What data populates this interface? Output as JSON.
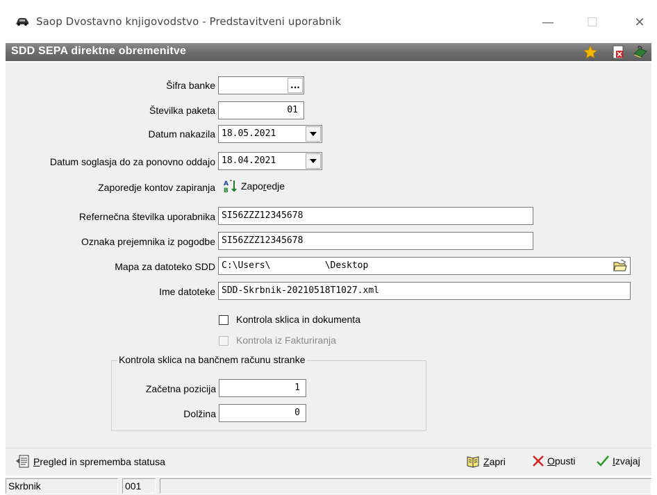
{
  "window": {
    "title": "Saop Dvostavno knjigovodstvo - Predstavitveni uporabnik",
    "minimize": "—",
    "maximize": "☐",
    "close": "✕"
  },
  "header": {
    "title": "SDD SEPA direktne obremenitve",
    "icons": [
      "star-icon",
      "document-delete-icon",
      "help-book-icon"
    ]
  },
  "form": {
    "bank_code": {
      "label": "Šifra banke",
      "value": "",
      "browse_label": "..."
    },
    "package_number": {
      "label": "Številka paketa",
      "value": "01"
    },
    "payment_date": {
      "label": "Datum nakazila",
      "value": "18.05.2021"
    },
    "consent_date": {
      "label": "Datum soglasja do za ponovno oddajo",
      "value": "18.04.2021"
    },
    "account_order": {
      "label": "Zaporedje kontov zapiranja",
      "button_label_pre": "Zapo",
      "button_label_ul": "r",
      "button_label_post": "edje"
    },
    "user_reference": {
      "label": "Refernečna številka uporabnika",
      "value": "SI56ZZZ12345678"
    },
    "recipient_mark": {
      "label": "Oznaka prejemnika iz pogodbe",
      "value": "SI56ZZZ12345678"
    },
    "sdd_folder": {
      "label": "Mapa za datoteko SDD",
      "value": "C:\\Users\\          \\Desktop"
    },
    "file_name": {
      "label": "Ime datoteke",
      "value": "SDD-Skrbnik-20210518T1027.xml"
    },
    "check_reference": {
      "label": "Kontrola sklica in dokumenta",
      "checked": false
    },
    "check_invoicing": {
      "label": "Kontrola iz Fakturiranja",
      "checked": false,
      "disabled": true
    },
    "group": {
      "title": "Kontrola sklica na bančnem računu stranke",
      "start_position": {
        "label": "Začetna pozicija",
        "value": "1"
      },
      "length": {
        "label": "Dolžina",
        "value": "0"
      }
    }
  },
  "footer": {
    "review": {
      "ul": "P",
      "rest": "regled in sprememba statusa"
    },
    "close": {
      "ul": "Z",
      "rest": "apri"
    },
    "cancel": {
      "ul": "O",
      "rest": "pusti"
    },
    "execute": {
      "ul": "I",
      "rest": "zvajaj"
    }
  },
  "status": {
    "user": "Skrbnik",
    "code": "001",
    "message": ""
  },
  "colors": {
    "header_bg": "#6d6d6d",
    "panel_bg": "#f0f0f0",
    "cancel_red": "#d42020",
    "execute_green": "#2e9a2e",
    "star_yellow": "#f5b800"
  }
}
